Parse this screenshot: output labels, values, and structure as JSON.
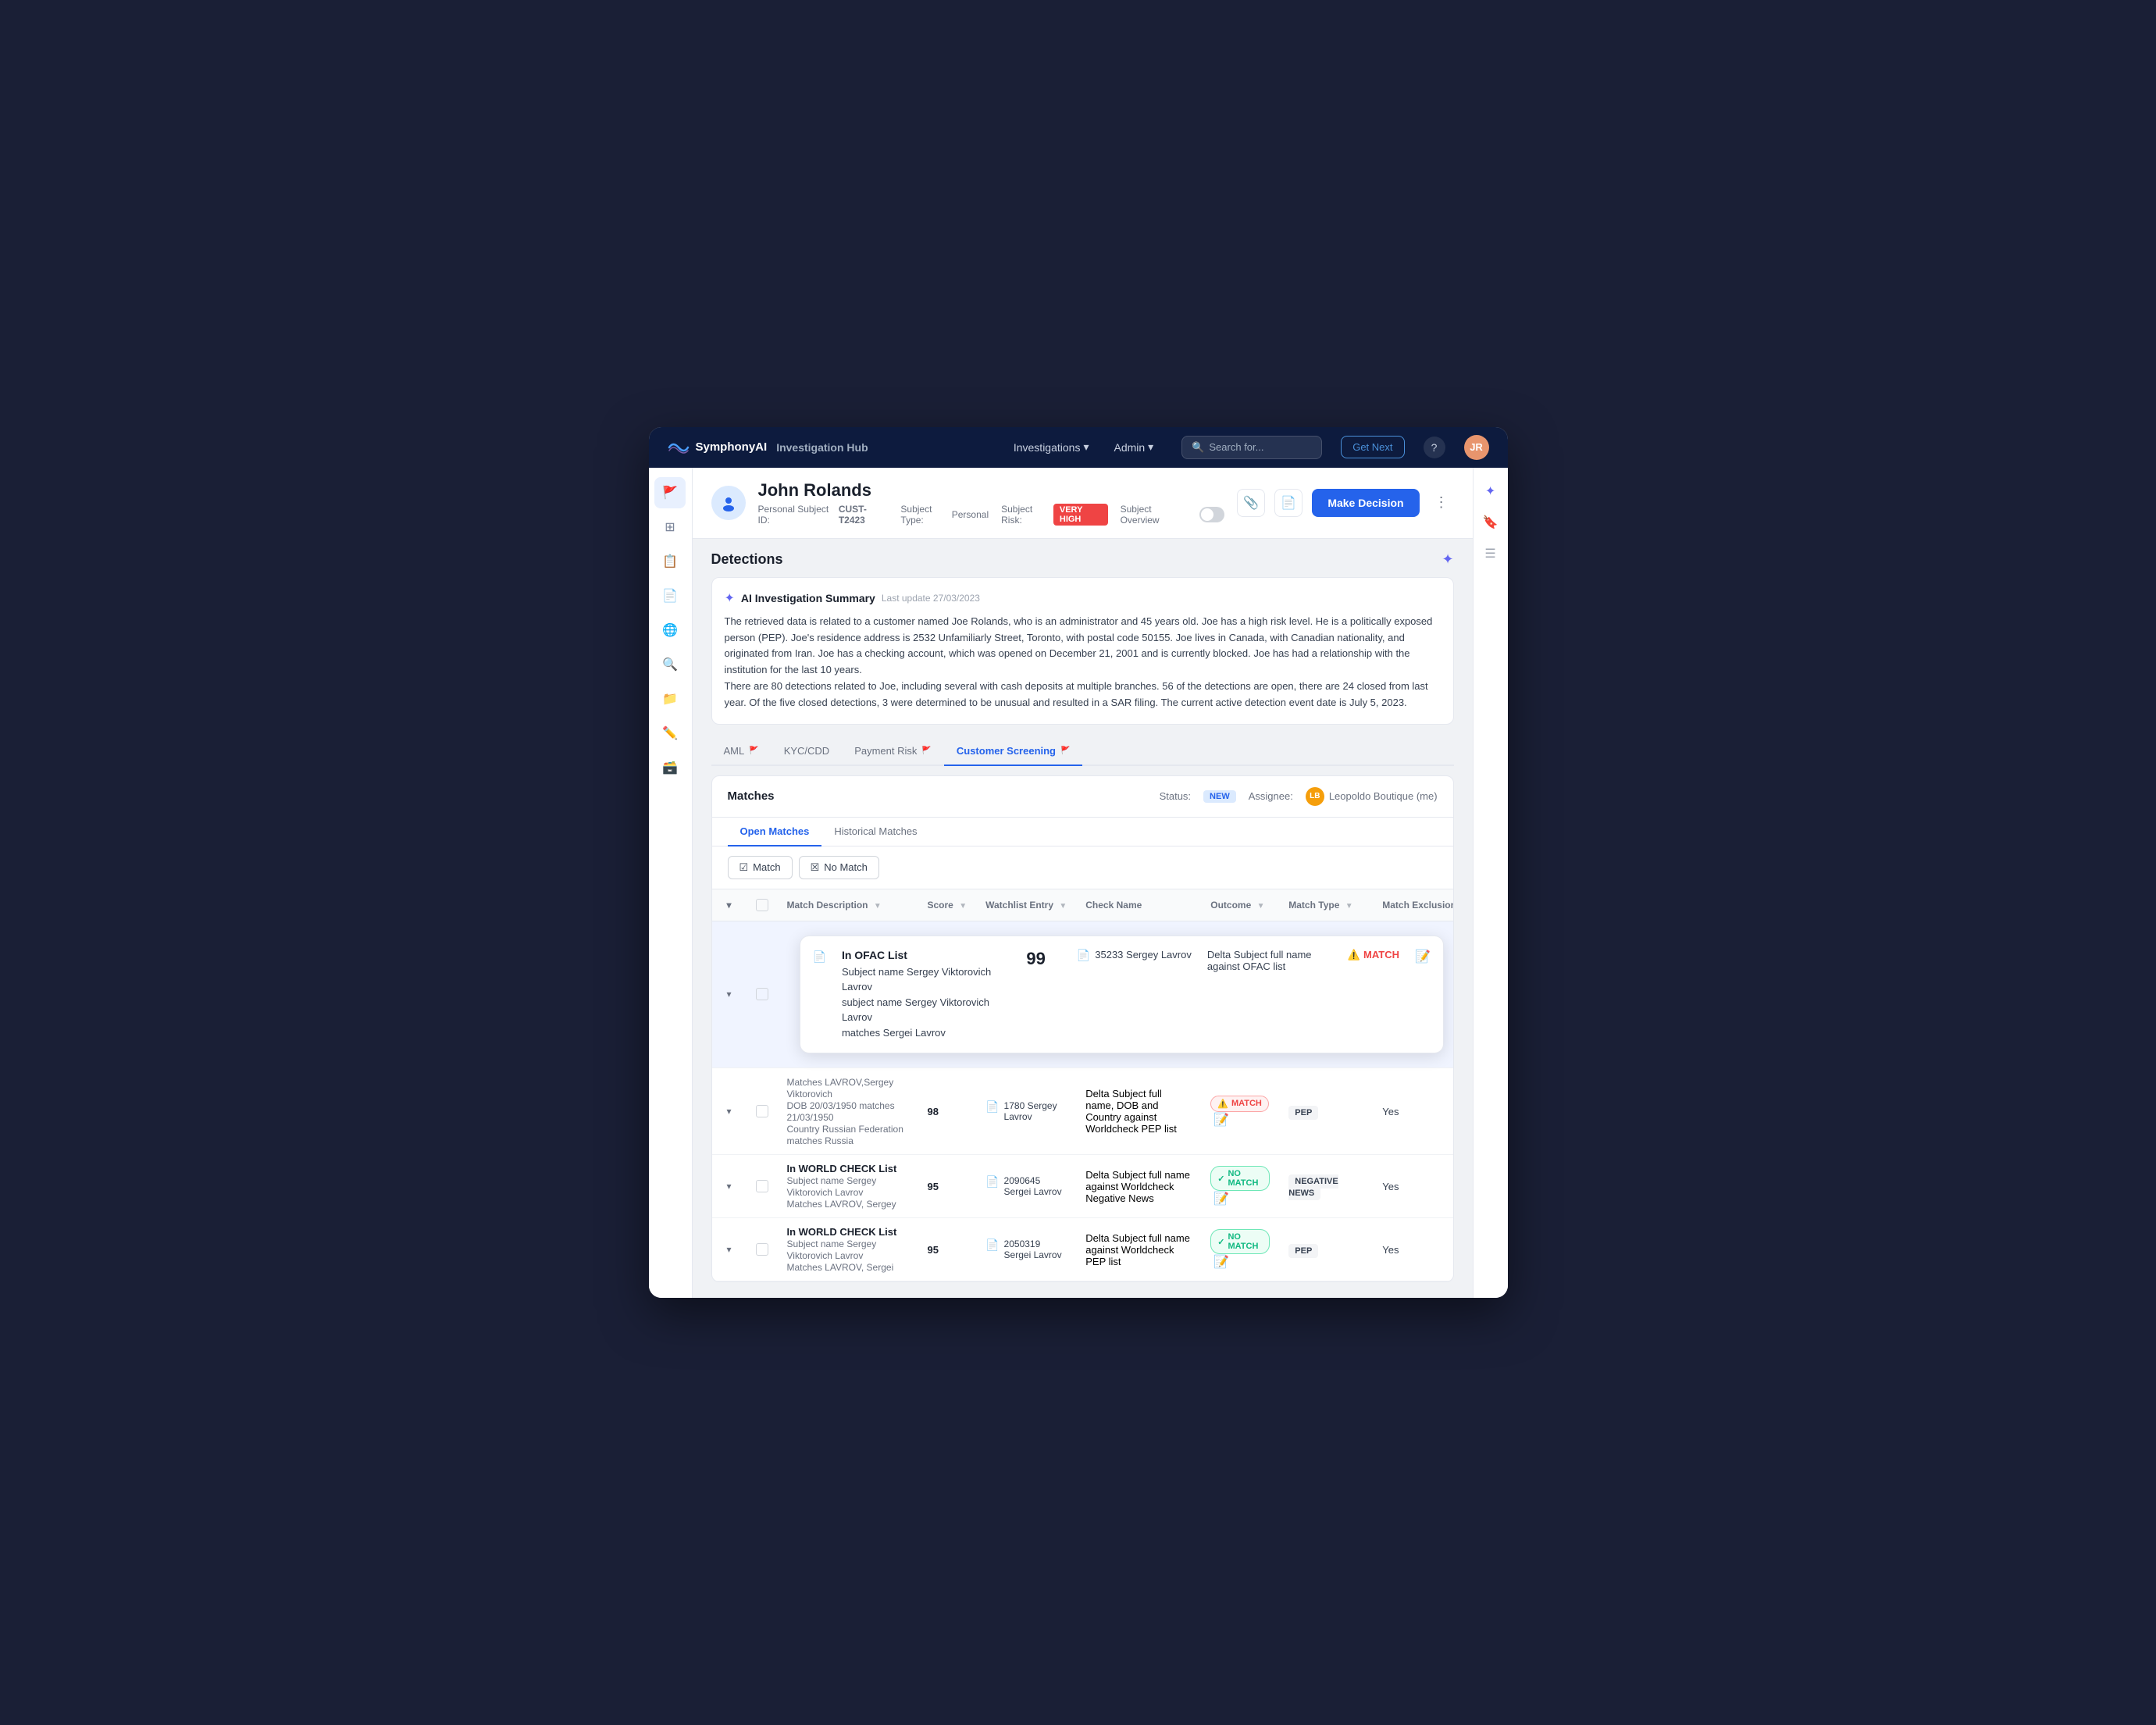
{
  "app": {
    "brand_name": "SymphonyAI",
    "hub_label": "Investigation Hub",
    "nav_investigations": "Investigations",
    "nav_admin": "Admin",
    "search_placeholder": "Search for...",
    "btn_get_next": "Get Next"
  },
  "subject": {
    "name": "John Rolands",
    "id_label": "Personal Subject ID:",
    "id_value": "CUST-T2423",
    "type_label": "Subject Type:",
    "type_value": "Personal",
    "risk_label": "Subject Risk:",
    "risk_value": "VERY HIGH",
    "overview_label": "Subject Overview",
    "btn_make_decision": "Make Decision"
  },
  "detections": {
    "title": "Detections",
    "ai_summary": {
      "title": "AI Investigation Summary",
      "date": "Last update 27/03/2023",
      "text": "The retrieved data is related to a customer named Joe Rolands, who is an administrator and 45 years old.  Joe has a high risk level. He is a politically exposed person (PEP). Joe's residence address is 2532 Unfamiliarly Street, Toronto, with postal code 50155. Joe lives in Canada, with  Canadian nationality, and originated from Iran.  Joe has a checking account, which was opened on December 21, 2001 and is currently blocked. Joe has had a relationship with the institution for the last 10 years.\nThere are 80 detections related to Joe, including several with cash deposits at multiple branches. 56 of the detections are open, there are 24 closed from last year. Of the five closed detections, 3 were determined to be unusual and resulted in a SAR filing.  The current active detection event date is July 5, 2023."
    },
    "tabs": [
      {
        "label": "AML",
        "flag": true,
        "active": false
      },
      {
        "label": "KYC/CDD",
        "flag": false,
        "active": false
      },
      {
        "label": "Payment Risk",
        "flag": true,
        "active": false
      },
      {
        "label": "Customer Screening",
        "flag": true,
        "active": true
      }
    ]
  },
  "matches": {
    "title": "Matches",
    "status_label": "Status:",
    "status_value": "NEW",
    "assignee_label": "Assignee:",
    "assignee_name": "Leopoldo Boutique (me)",
    "sub_tabs": [
      {
        "label": "Open Matches",
        "active": true
      },
      {
        "label": "Historical Matches",
        "active": false
      }
    ],
    "btn_match": "Match",
    "btn_no_match": "No Match",
    "table_headers": [
      "",
      "",
      "Match Description",
      "Score",
      "Watchlist Entry",
      "Check Name",
      "Outcome",
      "Match Type",
      "Match Exclusion"
    ],
    "rows": [
      {
        "expanded": true,
        "list_name": "In OFAC List",
        "desc_lines": [
          "Subject name Sergey Viktorovich Lavrov",
          "subject name Sergey Viktorovich Lavrov",
          "matches Sergei Lavrov"
        ],
        "score": "99",
        "watchlist_id": "35233 Sergey Lavrov",
        "check_name": "Delta Subject full name against OFAC list",
        "outcome": "MATCH",
        "outcome_type": "match",
        "match_type": "",
        "exclusion": ""
      },
      {
        "expanded": false,
        "list_name": "",
        "desc_lines": [
          "Matches LAVROV,Sergey Viktorovich",
          "DOB 20/03/1950 matches 21/03/1950",
          "Country Russian Federation matches Russia"
        ],
        "score": "98",
        "watchlist_id": "1780 Sergey Lavrov",
        "check_name": "Delta Subject full name, DOB and Country against Worldcheck PEP list",
        "outcome": "MATCH",
        "outcome_type": "match",
        "match_type": "PEP",
        "exclusion": "Yes"
      },
      {
        "expanded": false,
        "list_name": "In WORLD CHECK List",
        "desc_lines": [
          "Subject name Sergey Viktorovich Lavrov",
          "Matches LAVROV, Sergey"
        ],
        "score": "95",
        "watchlist_id": "2090645 Sergei Lavrov",
        "check_name": "Delta Subject full name against Worldcheck Negative News",
        "outcome": "NO MATCH",
        "outcome_type": "no-match",
        "match_type": "NEGATIVE NEWS",
        "exclusion": "Yes"
      },
      {
        "expanded": false,
        "list_name": "In WORLD CHECK List",
        "desc_lines": [
          "Subject name Sergey Viktorovich Lavrov",
          "Matches LAVROV, Sergei"
        ],
        "score": "95",
        "watchlist_id": "2050319 Sergei Lavrov",
        "check_name": "Delta Subject full name against Worldcheck PEP list",
        "outcome": "NO MATCH",
        "outcome_type": "no-match",
        "match_type": "PEP",
        "exclusion": "Yes"
      }
    ]
  }
}
